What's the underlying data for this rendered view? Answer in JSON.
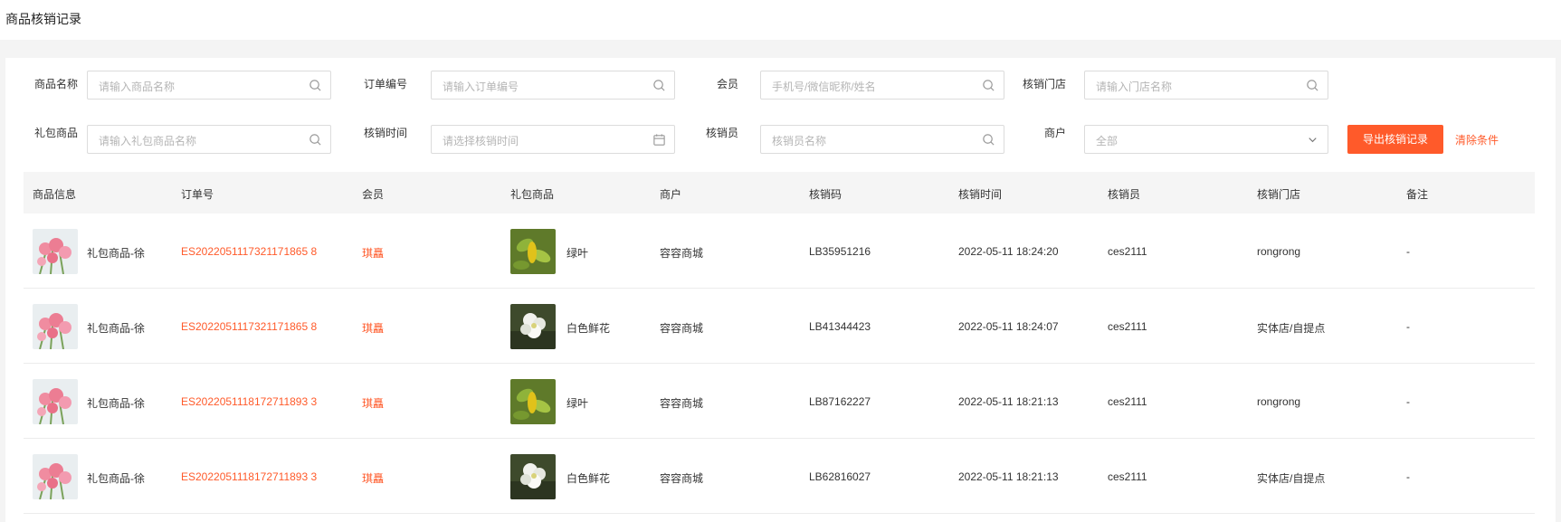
{
  "page": {
    "title": "商品核销记录"
  },
  "filters": {
    "product_name": {
      "label": "商品名称",
      "placeholder": "请输入商品名称"
    },
    "order_no": {
      "label": "订单编号",
      "placeholder": "请输入订单编号"
    },
    "member": {
      "label": "会员",
      "placeholder": "手机号/微信昵称/姓名"
    },
    "store": {
      "label": "核销门店",
      "placeholder": "请输入门店名称"
    },
    "gift_product": {
      "label": "礼包商品",
      "placeholder": "请输入礼包商品名称"
    },
    "verify_time": {
      "label": "核销时间",
      "placeholder": "请选择核销时间"
    },
    "verifier": {
      "label": "核销员",
      "placeholder": "核销员名称"
    },
    "merchant": {
      "label": "商户",
      "value": "全部"
    }
  },
  "actions": {
    "export": "导出核销记录",
    "clear": "清除条件"
  },
  "table": {
    "columns": [
      "商品信息",
      "订单号",
      "会员",
      "礼包商品",
      "商户",
      "核销码",
      "核销时间",
      "核销员",
      "核销门店",
      "备注"
    ],
    "rows": [
      {
        "product": "礼包商品-徐",
        "order": "ES2022051117321171865 8",
        "member": "琪矗",
        "gift": "绿叶",
        "gift_img": "leaf",
        "merchant": "容容商城",
        "code": "LB35951216",
        "time": "2022-05-11 18:24:20",
        "verifier": "ces2111",
        "store": "rongrong",
        "remark": "-"
      },
      {
        "product": "礼包商品-徐",
        "order": "ES2022051117321171865 8",
        "member": "琪矗",
        "gift": "白色鲜花",
        "gift_img": "flower",
        "merchant": "容容商城",
        "code": "LB41344423",
        "time": "2022-05-11 18:24:07",
        "verifier": "ces2111",
        "store": "实体店/自提点",
        "remark": "-"
      },
      {
        "product": "礼包商品-徐",
        "order": "ES2022051118172711893 3",
        "member": "琪矗",
        "gift": "绿叶",
        "gift_img": "leaf",
        "merchant": "容容商城",
        "code": "LB87162227",
        "time": "2022-05-11 18:21:13",
        "verifier": "ces2111",
        "store": "rongrong",
        "remark": "-"
      },
      {
        "product": "礼包商品-徐",
        "order": "ES2022051118172711893 3",
        "member": "琪矗",
        "gift": "白色鲜花",
        "gift_img": "flower",
        "merchant": "容容商城",
        "code": "LB62816027",
        "time": "2022-05-11 18:21:13",
        "verifier": "ces2111",
        "store": "实体店/自提点",
        "remark": "-"
      }
    ]
  },
  "colors": {
    "accent": "#ff5a2a",
    "header_bg": "#f5f5f5",
    "page_bg": "#f4f4f4"
  }
}
